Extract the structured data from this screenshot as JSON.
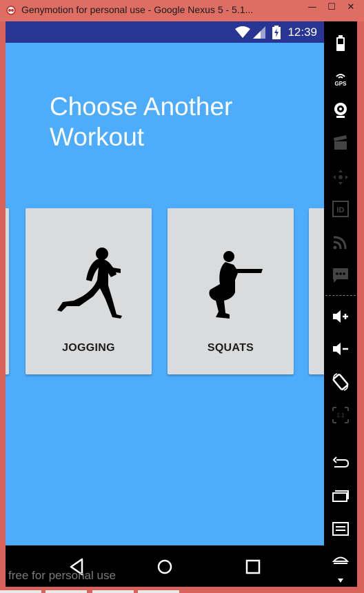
{
  "window": {
    "title": "Genymotion for personal use - Google Nexus 5 - 5.1...",
    "minimize_glyph": "—",
    "maximize_glyph": "☐",
    "close_glyph": "✕"
  },
  "status_bar": {
    "time": "12:39",
    "icons": [
      "wifi-icon",
      "signal-icon",
      "battery-charging-icon"
    ]
  },
  "screen": {
    "heading": "Choose Another Workout",
    "background": "#4dadfc",
    "cards": [
      {
        "label": "JOGGING",
        "icon": "runner-silhouette"
      },
      {
        "label": "SQUATS",
        "icon": "squat-silhouette"
      }
    ]
  },
  "nav_bar": {
    "buttons": [
      "back-icon",
      "home-icon",
      "recents-icon"
    ]
  },
  "watermark": "free for personal use",
  "side_panel": {
    "icons": [
      "battery-icon",
      "gps-icon",
      "camera-icon",
      "clapper-icon",
      "dpad-icon",
      "id-icon",
      "cast-icon",
      "sms-icon",
      "volume-up-icon",
      "volume-down-icon",
      "rotate-icon",
      "pixel-perfect-icon",
      "back-icon",
      "recents-icon",
      "menu-icon",
      "home-icon"
    ],
    "gps_label": "GPS",
    "id_label": "ID",
    "scale_label": "1:1"
  }
}
